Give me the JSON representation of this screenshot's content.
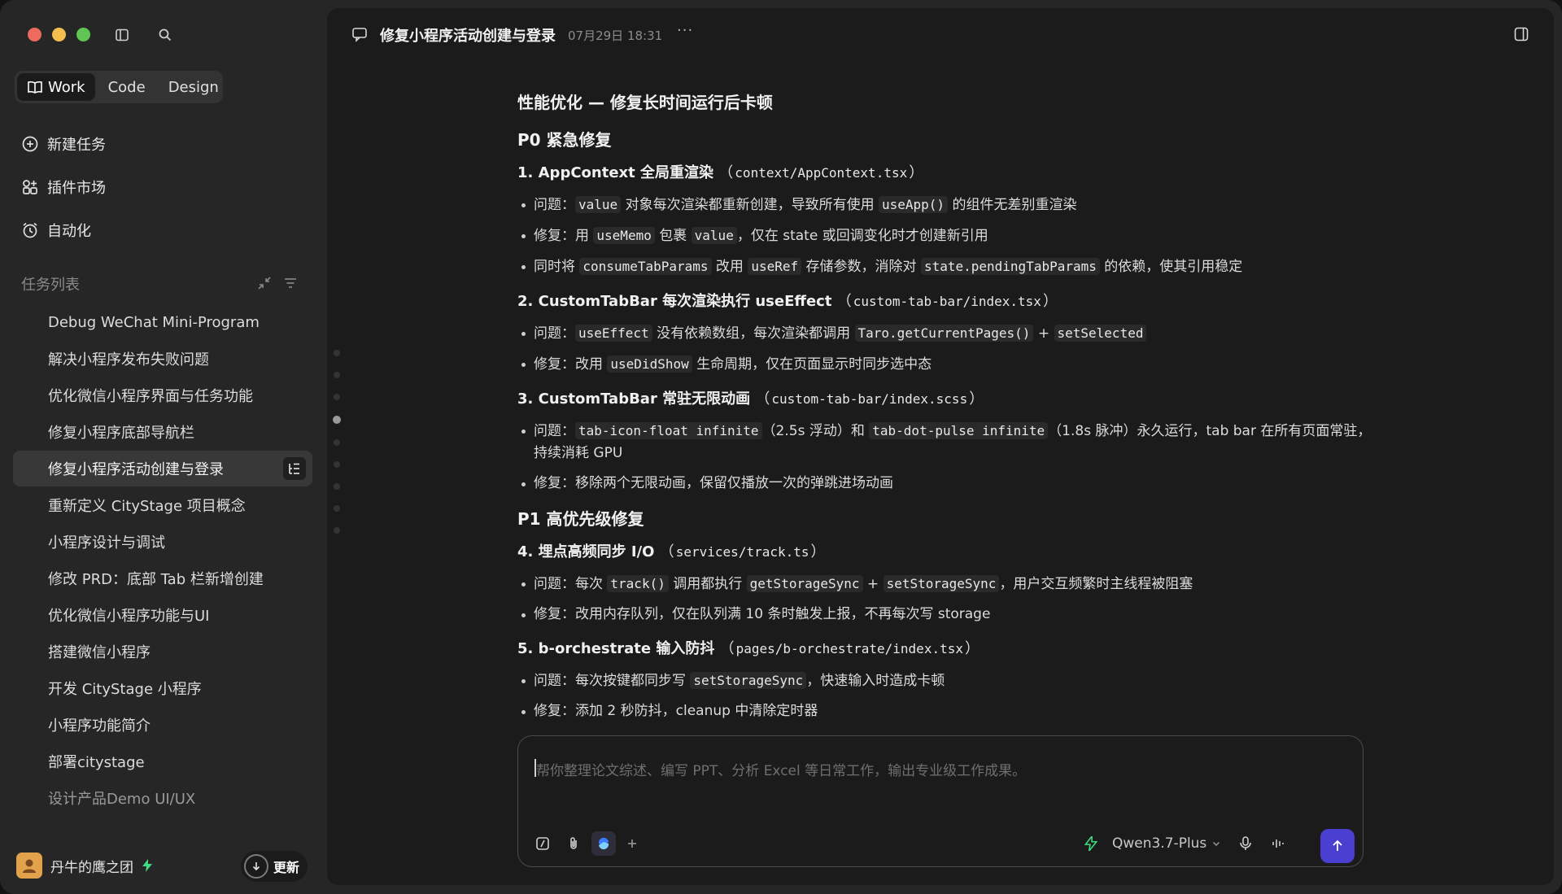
{
  "sidebar": {
    "modes": [
      "Work",
      "Code",
      "Design"
    ],
    "nav": {
      "new_task": "新建任务",
      "plugins": "插件市场",
      "automation": "自动化"
    },
    "section_title": "任务列表",
    "tasks": [
      "Debug WeChat Mini-Program",
      "解决小程序发布失败问题",
      "优化微信小程序界面与任务功能",
      "修复小程序底部导航栏",
      "修复小程序活动创建与登录",
      "重新定义 CityStage 项目概念",
      "小程序设计与调试",
      "修改 PRD：底部 Tab 栏新增创建",
      "优化微信小程序功能与UI",
      "搭建微信小程序",
      "开发 CityStage 小程序",
      "小程序功能简介",
      "部署citystage",
      "设计产品Demo UI/UX"
    ],
    "user_name": "丹牛的鹰之团",
    "update_label": "更新"
  },
  "header": {
    "title": "修复小程序活动创建与登录",
    "time": "07月29日 18:31",
    "more": "···"
  },
  "content": {
    "title": "性能优化 — 修复长时间运行后卡顿",
    "p0_heading": "P0 紧急修复",
    "item1_title": "1. AppContext 全局重渲染",
    "item1_file": "context/AppContext.tsx",
    "item1_b1_a": "问题：",
    "item1_b1_code1": "value",
    "item1_b1_b": " 对象每次渲染都重新创建，导致所有使用 ",
    "item1_b1_code2": "useApp()",
    "item1_b1_c": " 的组件无差别重渲染",
    "item1_b2_a": "修复：用 ",
    "item1_b2_code1": "useMemo",
    "item1_b2_b": " 包裹 ",
    "item1_b2_code2": "value",
    "item1_b2_c": "，仅在 state 或回调变化时才创建新引用",
    "item1_b3_a": "同时将 ",
    "item1_b3_code1": "consumeTabParams",
    "item1_b3_b": " 改用 ",
    "item1_b3_code2": "useRef",
    "item1_b3_c": " 存储参数，消除对 ",
    "item1_b3_code3": "state.pendingTabParams",
    "item1_b3_d": " 的依赖，使其引用稳定",
    "item2_title": "2. CustomTabBar 每次渲染执行 useEffect",
    "item2_file": "custom-tab-bar/index.tsx",
    "item2_b1_a": "问题：",
    "item2_b1_code1": "useEffect",
    "item2_b1_b": " 没有依赖数组，每次渲染都调用 ",
    "item2_b1_code2": "Taro.getCurrentPages()",
    "item2_b1_c": " + ",
    "item2_b1_code3": "setSelected",
    "item2_b2_a": "修复：改用 ",
    "item2_b2_code1": "useDidShow",
    "item2_b2_b": " 生命周期，仅在页面显示时同步选中态",
    "item3_title": "3. CustomTabBar 常驻无限动画",
    "item3_file": "custom-tab-bar/index.scss",
    "item3_b1_a": "问题：",
    "item3_b1_code1": "tab-icon-float infinite",
    "item3_b1_b": "（2.5s 浮动）和 ",
    "item3_b1_code2": "tab-dot-pulse infinite",
    "item3_b1_c": "（1.8s 脉冲）永久运行，tab bar 在所有页面常驻，持续消耗 GPU",
    "item3_b2": "修复：移除两个无限动画，保留仅播放一次的弹跳进场动画",
    "p1_heading": "P1 高优先级修复",
    "item4_title": "4. 埋点高频同步 I/O",
    "item4_file": "services/track.ts",
    "item4_b1_a": "问题：每次 ",
    "item4_b1_code1": "track()",
    "item4_b1_b": " 调用都执行 ",
    "item4_b1_code2": "getStorageSync",
    "item4_b1_c": " + ",
    "item4_b1_code3": "setStorageSync",
    "item4_b1_d": "，用户交互频繁时主线程被阻塞",
    "item4_b2": "修复：改用内存队列，仅在队列满 10 条时触发上报，不再每次写 storage",
    "item5_title": "5. b-orchestrate 输入防抖",
    "item5_file": "pages/b-orchestrate/index.tsx",
    "item5_b1_a": "问题：每次按键都同步写 ",
    "item5_b1_code1": "setStorageSync",
    "item5_b1_b": "，快速输入时造成卡顿",
    "item5_b2": "修复：添加 2 秒防抖，cleanup 中清除定时器"
  },
  "composer": {
    "placeholder": "帮你整理论文综述、编写 PPT、分析 Excel 等日常工作，输出专业级工作成果。",
    "model": "Qwen3.7-Plus"
  },
  "colors": {
    "accent": "#4b3fd1",
    "traffic_red": "#ed6a5e",
    "traffic_yellow": "#f5bf4f",
    "traffic_green": "#61c554",
    "bolt_green": "#3ddc84"
  }
}
